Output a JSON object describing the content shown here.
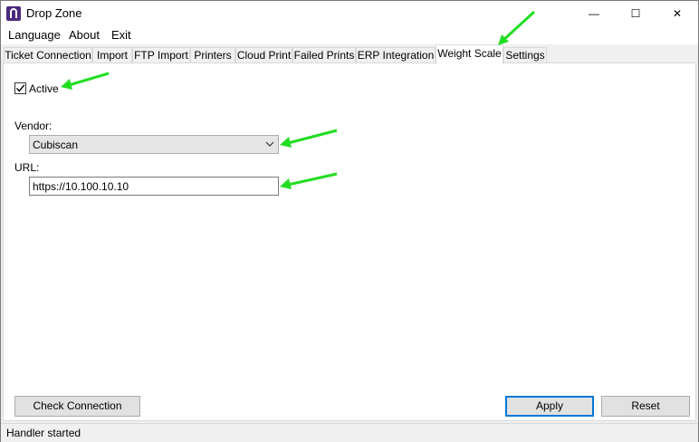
{
  "window": {
    "title": "Drop Zone",
    "minimize_symbol": "—",
    "maximize_symbol": "☐",
    "close_symbol": "✕"
  },
  "menu": [
    "Language",
    "About",
    "Exit"
  ],
  "tabs": [
    {
      "label": "Ticket Connection"
    },
    {
      "label": "Import"
    },
    {
      "label": "FTP Import"
    },
    {
      "label": "Printers"
    },
    {
      "label": "Cloud Print"
    },
    {
      "label": "Failed Prints"
    },
    {
      "label": "ERP Integration"
    },
    {
      "label": "Weight Scale"
    },
    {
      "label": "Settings"
    }
  ],
  "active_tab": "Weight Scale",
  "form": {
    "active_label": "Active",
    "active_checked": true,
    "vendor_label": "Vendor:",
    "vendor_value": "Cubiscan",
    "url_label": "URL:",
    "url_value": "https://10.100.10.10"
  },
  "buttons": {
    "check_connection": "Check Connection",
    "apply": "Apply",
    "reset": "Reset"
  },
  "status": {
    "text": "Handler started"
  },
  "colors": {
    "annotation_arrow": "#22dd22",
    "focus_border": "#0078d7",
    "app_icon": "#4b2a7a"
  }
}
